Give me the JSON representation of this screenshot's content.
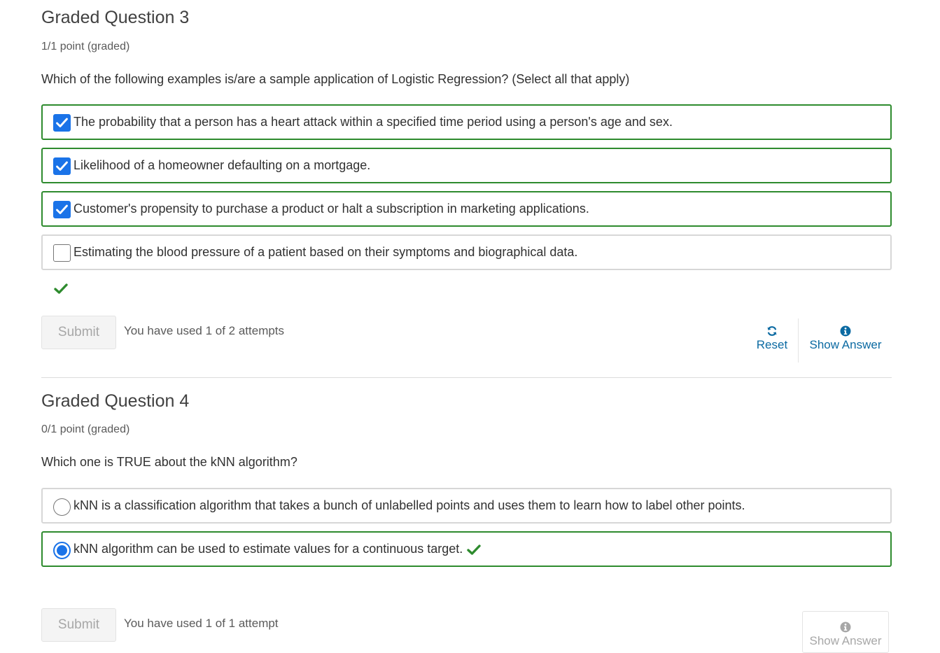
{
  "q3": {
    "title": "Graded Question 3",
    "points": "1/1 point (graded)",
    "prompt": "Which of the following examples is/are a sample application of Logistic Regression? (Select all that apply)",
    "choices": [
      {
        "label": "The probability that a person has a heart attack within a specified time period using a person's age and sex.",
        "checked": true
      },
      {
        "label": "Likelihood of a homeowner defaulting on a mortgage.",
        "checked": true
      },
      {
        "label": "Customer's propensity to purchase a product or halt a subscription in marketing applications.",
        "checked": true
      },
      {
        "label": "Estimating the blood pressure of a patient based on their symptoms and biographical data.",
        "checked": false
      }
    ],
    "submit_label": "Submit",
    "attempts": "You have used 1 of 2 attempts",
    "reset_label": "Reset",
    "show_answer_label": "Show Answer"
  },
  "q4": {
    "title": "Graded Question 4",
    "points": "0/1 point (graded)",
    "prompt": "Which one is TRUE about the kNN algorithm?",
    "choices": [
      {
        "label": "kNN is a classification algorithm that takes a bunch of unlabelled points and uses them to learn how to label other points.",
        "selected": false
      },
      {
        "label": "kNN algorithm can be used to estimate values for a continuous target.",
        "selected": true
      }
    ],
    "submit_label": "Submit",
    "attempts": "You have used 1 of 1 attempt",
    "show_answer_label": "Show Answer"
  },
  "colors": {
    "correct": "#2e8b2e",
    "accent": "#1a73e8",
    "link": "#0b6aa2"
  },
  "icons": {
    "correct": "checkmark-icon",
    "reset": "refresh-icon",
    "show_answer": "info-icon"
  }
}
